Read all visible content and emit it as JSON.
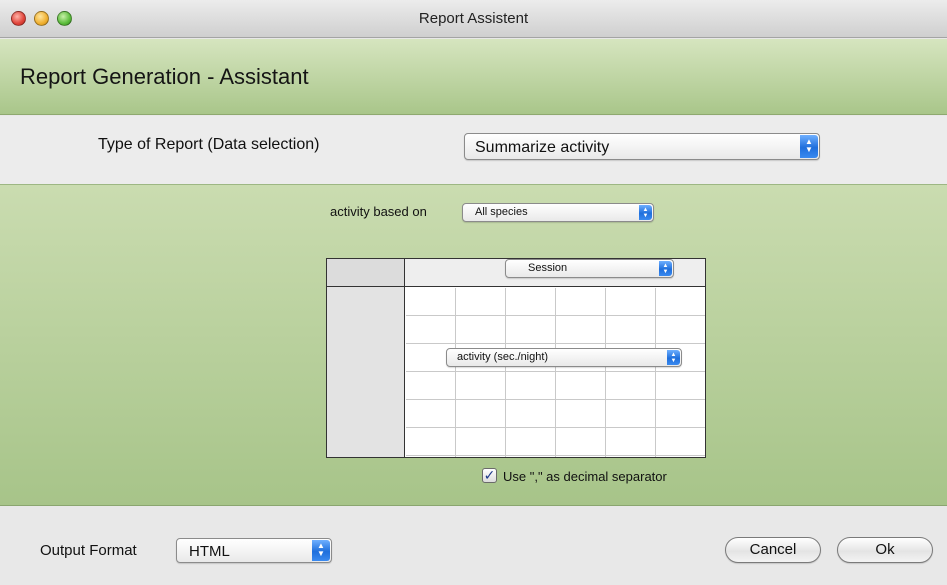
{
  "window": {
    "title": "Report Assistent",
    "controls": [
      "close",
      "minimize",
      "zoom"
    ]
  },
  "header": {
    "title": "Report Generation - Assistant"
  },
  "report_type": {
    "label": "Type of Report (Data selection)",
    "selected": "Summarize activity"
  },
  "activity": {
    "based_on_label": "activity based on",
    "species_selected": "All species"
  },
  "grid": {
    "column_field": "Session",
    "value_field": "activity (sec./night)"
  },
  "decimal": {
    "label": "Use \",\" as decimal separator",
    "checked": true
  },
  "footer": {
    "output_label": "Output Format",
    "output_selected": "HTML",
    "cancel_label": "Cancel",
    "ok_label": "Ok"
  },
  "colors": {
    "accent_green_light": "#d6e5bf",
    "accent_green_dark": "#a9c68a",
    "popup_blue": "#1f6fdc"
  }
}
